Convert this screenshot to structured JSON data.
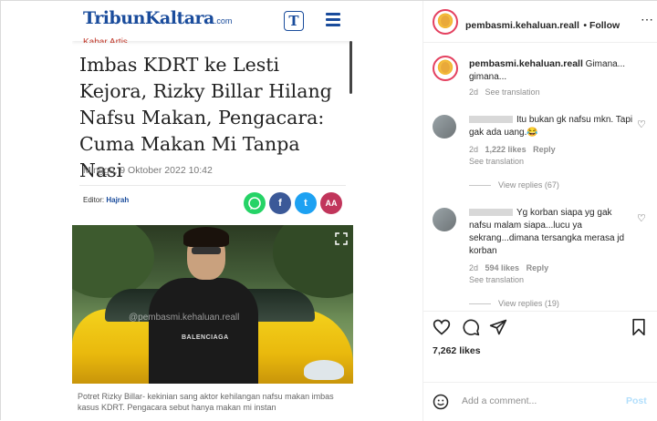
{
  "article": {
    "site_logo": "TribunKaltara",
    "site_logo_suffix": ".com",
    "t_icon": "T",
    "kicker": "Kabar Artis",
    "headline": "Imbas KDRT ke Lesti Kejora, Rizky Billar Hilang Nafsu Makan, Pengacara: Cuma Makan Mi Tanpa Nasi",
    "date": "Minggu, 9 Oktober 2022 10:42",
    "editor_label": "Editor:",
    "editor_name": "Hajrah",
    "share_font_label": "AA",
    "share_facebook": "f",
    "share_twitter": "t",
    "shirt_text": "BALENCIAGA",
    "watermark": "@pembasmi.kehaluan.reall",
    "caption": "Potret Rizky Billar- kekinian sang aktor kehilangan nafsu makan imbas kasus KDRT. Pengacara sebut hanya makan mi instan",
    "colors": {
      "brand": "#1a4c9c",
      "whatsapp": "#25d366",
      "facebook": "#3b5998",
      "twitter": "#1da1f2",
      "font": "#c1355b"
    }
  },
  "instagram": {
    "username": "pembasmi.kehaluan.reall",
    "follow_label": "Follow",
    "caption": {
      "username": "pembasmi.kehaluan.reall",
      "text": "Gimana... gimana...",
      "age": "2d",
      "see_translation": "See translation"
    },
    "comments": [
      {
        "text": "Itu bukan gk nafsu mkn. Tapi gak ada uang.😂",
        "age": "2d",
        "likes": "1,222 likes",
        "reply": "Reply",
        "see_translation": "See translation",
        "view_replies": "View replies (67)"
      },
      {
        "text": "Yg korban siapa yg gak nafsu malam siapa...lucu ya sekrang...dimana tersangka merasa jd korban",
        "age": "2d",
        "likes": "594 likes",
        "reply": "Reply",
        "see_translation": "See translation",
        "view_replies": "View replies (19)"
      }
    ],
    "likes_count": "7,262 likes",
    "add_comment_placeholder": "Add a comment...",
    "post_label": "Post",
    "colors": {
      "text": "#262626",
      "muted": "#8e8e8e",
      "post_disabled": "#b2dffc"
    },
    "icons": [
      "heart-icon",
      "comment-icon",
      "share-icon",
      "bookmark-icon",
      "emoji-icon",
      "more-icon"
    ]
  }
}
